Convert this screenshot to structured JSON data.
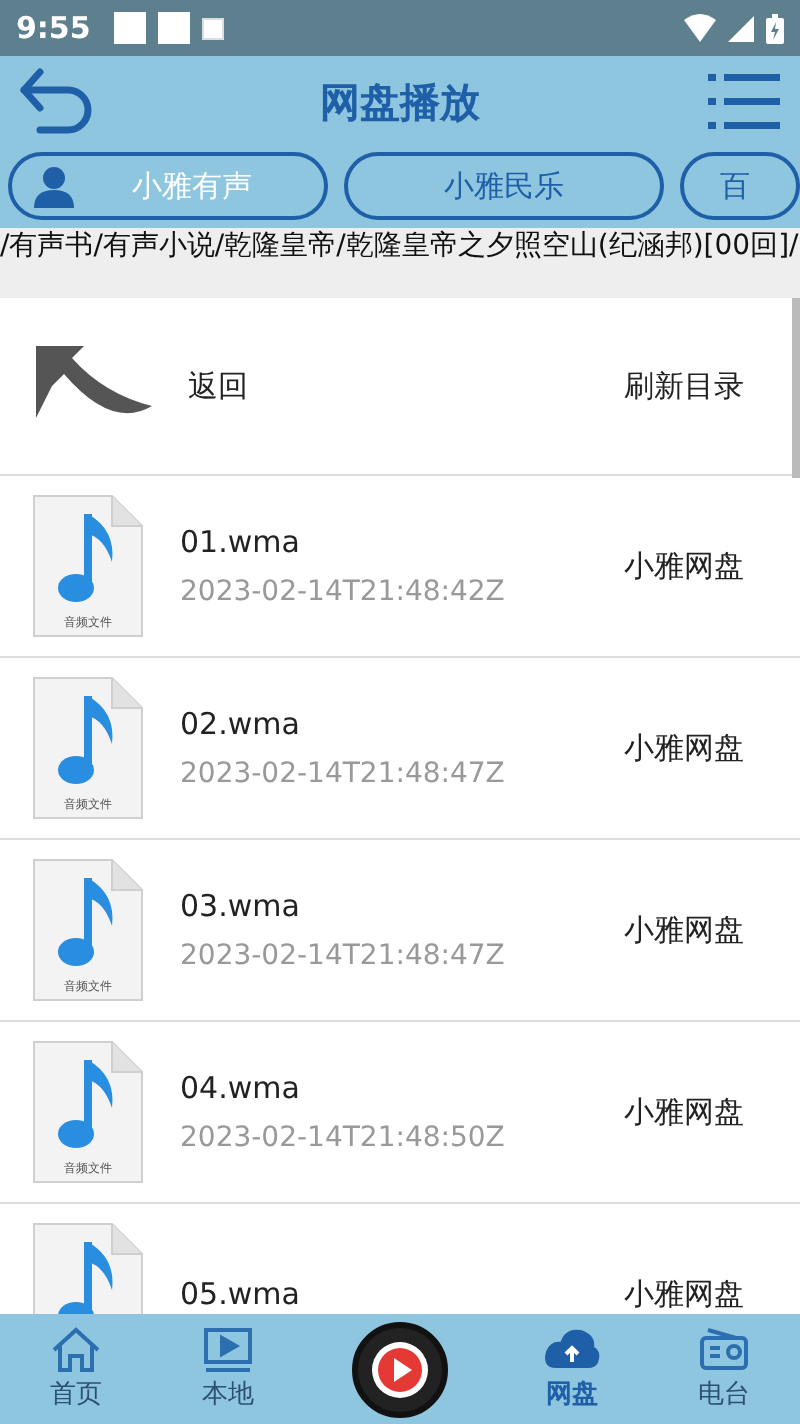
{
  "status_bar": {
    "time": "9:55"
  },
  "header": {
    "title": "网盘播放"
  },
  "tabs": [
    {
      "label": "小雅有声",
      "selected": true
    },
    {
      "label": "小雅民乐",
      "selected": false
    },
    {
      "label": "百",
      "selected": false
    }
  ],
  "path": "/有声书/有声小说/乾隆皇帝/乾隆皇帝之夕照空山(纪涵邦)[00回]/",
  "back_row": {
    "label": "返回",
    "action": "刷新目录"
  },
  "files": [
    {
      "name": "01.wma",
      "date": "2023-02-14T21:48:42Z",
      "source": "小雅网盘",
      "icon_label": "音频文件"
    },
    {
      "name": "02.wma",
      "date": "2023-02-14T21:48:47Z",
      "source": "小雅网盘",
      "icon_label": "音频文件"
    },
    {
      "name": "03.wma",
      "date": "2023-02-14T21:48:47Z",
      "source": "小雅网盘",
      "icon_label": "音频文件"
    },
    {
      "name": "04.wma",
      "date": "2023-02-14T21:48:50Z",
      "source": "小雅网盘",
      "icon_label": "音频文件"
    },
    {
      "name": "05.wma",
      "source": "小雅网盘"
    }
  ],
  "bottom_nav": [
    {
      "kind": "home",
      "label": "首页",
      "selected": false
    },
    {
      "kind": "local",
      "label": "本地",
      "selected": false
    },
    {
      "kind": "player"
    },
    {
      "kind": "cloud",
      "label": "网盘",
      "selected": true
    },
    {
      "kind": "radio",
      "label": "电台",
      "selected": false
    }
  ]
}
